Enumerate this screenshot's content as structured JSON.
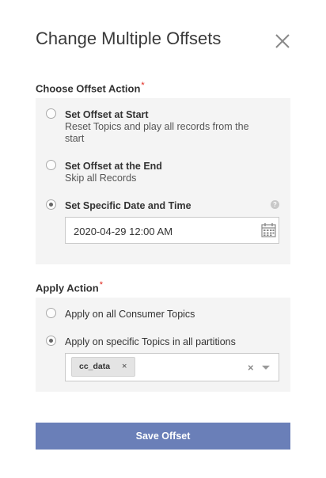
{
  "dialog": {
    "title": "Change Multiple Offsets"
  },
  "offset_action": {
    "label": "Choose Offset Action",
    "required_mark": "*",
    "options": [
      {
        "title": "Set Offset at Start",
        "subtitle_line1": "Reset Topics and play all records from the",
        "subtitle_line2": "start",
        "checked": false
      },
      {
        "title": "Set Offset at the End",
        "subtitle_line1": "Skip all Records",
        "checked": false
      },
      {
        "title": "Set Specific Date and Time",
        "checked": true
      }
    ],
    "help_glyph": "?",
    "date_value": "2020-04-29 12:00 AM"
  },
  "apply_action": {
    "label": "Apply Action",
    "required_mark": "*",
    "options": [
      {
        "text": "Apply on all Consumer Topics",
        "checked": false
      },
      {
        "text": "Apply on specific Topics in all partitions",
        "checked": true
      }
    ],
    "selected_topics": [
      "cc_data"
    ],
    "chip_remove_glyph": "×",
    "clear_glyph": "×"
  },
  "footer": {
    "save_label": "Save Offset"
  },
  "colors": {
    "primary_button": "#6a7fb8",
    "required": "#e0241b",
    "panel_bg": "#f4f4f4"
  },
  "icons": [
    "close-icon",
    "help-icon",
    "calendar-icon",
    "chip-remove-icon",
    "clear-selection-icon",
    "chevron-down-icon"
  ]
}
